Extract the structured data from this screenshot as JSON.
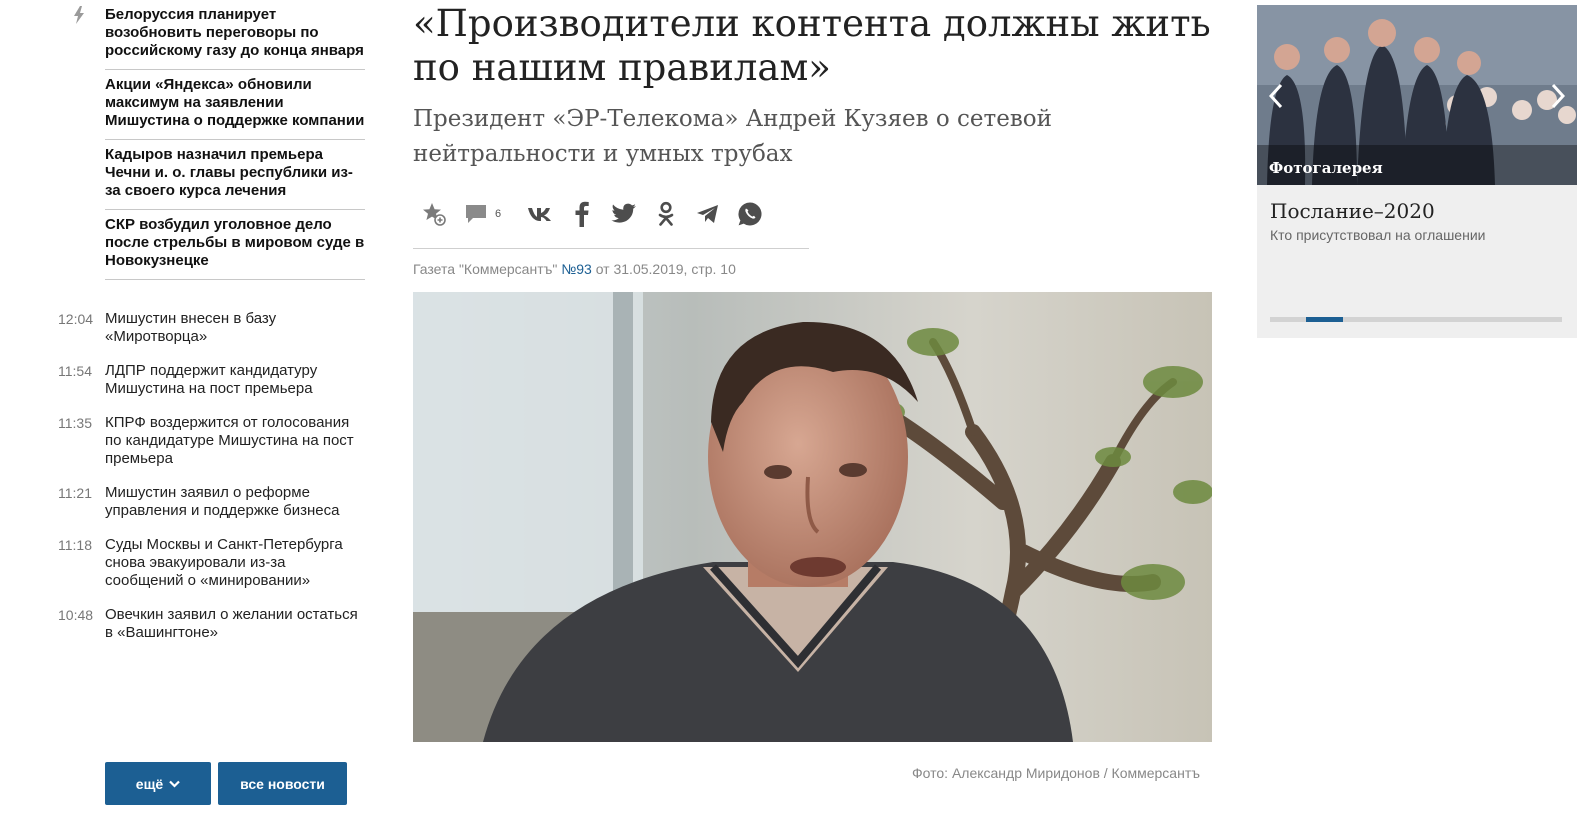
{
  "top_news": [
    "Белоруссия планирует возобновить переговоры по российскому газу до конца января",
    "Акции «Яндекса» обновили максимум на заявлении Мишустина о поддержке компании",
    "Кадыров назначил премьера Чечни и. о. главы республики из-за своего курса лечения",
    "СКР возбудил уголовное дело после стрельбы в мировом суде в Новокузнецке"
  ],
  "feed": [
    {
      "time": "12:04",
      "text": "Мишустин внесен в базу «Миротворца»"
    },
    {
      "time": "11:54",
      "text": "ЛДПР поддержит кандидатуру Мишустина на пост премьера"
    },
    {
      "time": "11:35",
      "text": "КПРФ воздержится от голосования по кандидатуре Мишустина на пост премьера"
    },
    {
      "time": "11:21",
      "text": "Мишустин заявил о реформе управления и поддержке бизнеса"
    },
    {
      "time": "11:18",
      "text": "Суды Москвы и Санкт-Петербурга снова эвакуировали из-за сообщений о «минировании»"
    },
    {
      "time": "10:48",
      "text": "Овечкин заявил о желании остаться в «Вашингтоне»"
    }
  ],
  "buttons": {
    "more": "ещё",
    "all_news": "все новости"
  },
  "article": {
    "headline": "«Производители контента должны жить по нашим правилам»",
    "subheadline": "Президент «ЭР-Телекома» Андрей Кузяев о сетевой нейтральности и умных трубах",
    "comment_count": "6",
    "meta_prefix": "Газета \"Коммерсантъ\" ",
    "issue": "№93",
    "meta_suffix": " от 31.05.2019, стр. 10",
    "photo_caption": "Фото: Александр Миридонов / Коммерсантъ"
  },
  "gallery": {
    "tag": "Фотогалерея",
    "title": "Послание–2020",
    "subtitle": "Кто присутствовал на оглашении",
    "slide_progress": 0.12
  },
  "colors": {
    "accent": "#1c5f93",
    "text": "#222222",
    "muted": "#888888"
  },
  "icons": [
    "lightning-icon",
    "favorite-add-icon",
    "comment-icon",
    "vk-icon",
    "facebook-icon",
    "twitter-icon",
    "odnoklassniki-icon",
    "telegram-icon",
    "whatsapp-icon",
    "chevron-down-icon",
    "arrow-left-icon",
    "arrow-right-icon"
  ]
}
